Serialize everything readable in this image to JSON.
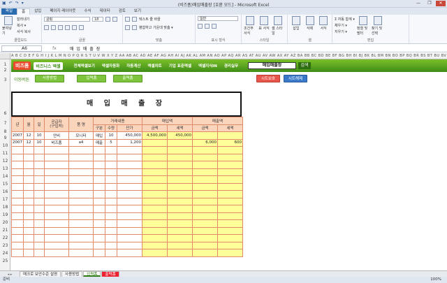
{
  "window": {
    "title": "(비즈폼)매입매출장  [호환 모드]  -  Microsoft Excel",
    "qat": [
      "▣",
      "↶",
      "↷",
      "▾"
    ],
    "buttons": [
      "—",
      "❐",
      "✕"
    ]
  },
  "ribbon_tabs": [
    "파일",
    "홈",
    "삽입",
    "페이지 레이아웃",
    "수식",
    "데이터",
    "검토",
    "보기"
  ],
  "ribbon": {
    "clipboard": {
      "paste": "붙여넣기",
      "cut": "잘라내기",
      "copy": "복사 ▾",
      "format_painter": "서식 복사",
      "label": "클립보드"
    },
    "font": {
      "name": "굴림",
      "size": "18",
      "label": "글꼴"
    },
    "align": {
      "wrap": "텍스트 줄 바꿈",
      "merge": "병합하고 가운데 맞춤 ▾",
      "label": "맞춤"
    },
    "number": {
      "format": "일반",
      "label": "표시 형식"
    },
    "styles": {
      "cond": "조건부 서식",
      "table": "표 서식",
      "cell": "셀 스타일",
      "label": "스타일"
    },
    "cells": {
      "insert": "삽입",
      "delete": "삭제",
      "format": "서식",
      "label": "셀"
    },
    "editing": {
      "autosum": "Σ 자동 합계 ▾",
      "fill": "채우기 ▾",
      "clear": "지우기 ▾",
      "sort": "정렬 및 필터",
      "find": "찾기 및 선택",
      "label": "편집"
    }
  },
  "formula_bar": {
    "name_box": "A6",
    "fx": "fx",
    "value": "매 입 매 출 장"
  },
  "col_headers": "A B C D E F G H I J K L M N O P Q R S T U V W X Y Z AA AB AC AD AE AF AG AH AI AJ AK AL AM AN AO AP AQ AR AS AT AU AV AW AX AY AZ BA BB BC BD BE BF BG BH BI BJ BK BL BM BN BO BP BQ BR BS BT BU BV BW BX BY BZ CA CB CC CD CE CF CG",
  "row_numbers": [
    "1",
    "2",
    "3",
    "",
    "6",
    "7",
    "8",
    "9",
    "10",
    "11",
    "12",
    "13",
    "14",
    "15",
    "16",
    "17",
    "18",
    "19",
    "20",
    "21",
    "22",
    "23",
    "24",
    "25"
  ],
  "nav": {
    "logo": "비즈폼",
    "logo2": "비즈니스 엑셀",
    "menu": [
      "전체엑셀보기",
      "엑셀자동화",
      "자동계산",
      "엑셀차트",
      "기업 표준엑셀",
      "엑셀지식IN",
      "경리실무"
    ],
    "select_value": "매입매출장",
    "search": "검색"
  },
  "move_label": "이동버튼",
  "buttons": [
    "사용방법",
    "입력폼",
    "출력폼"
  ],
  "sheet_protect": "시트보호",
  "sheet_unprotect": "시트해제",
  "sheet_title": "매 입 매 출 장",
  "table": {
    "h1": [
      "년",
      "월",
      "일",
      "공급자\n(구입처)",
      "품  명",
      "거래내용",
      "매입액",
      "매출액"
    ],
    "h2": [
      "구분",
      "수량",
      "단가",
      "금액",
      "세액",
      "금액",
      "세액"
    ],
    "rows": [
      [
        "2007",
        "12",
        "10",
        "안비",
        "모니터",
        "매입",
        "10",
        "450,000",
        "4,500,000",
        "450,000",
        "",
        ""
      ],
      [
        "2007",
        "12",
        "10",
        "비즈폼",
        "a4",
        "매출",
        "5",
        "1,200",
        "",
        "",
        "6,000",
        "600"
      ]
    ],
    "empty_rows": 15
  },
  "sheet_tabs": [
    "매크로 보안수준 설명",
    "사용방법",
    "입력폼",
    "출력폼"
  ],
  "status": {
    "left": "준비",
    "zoom": "100%"
  }
}
